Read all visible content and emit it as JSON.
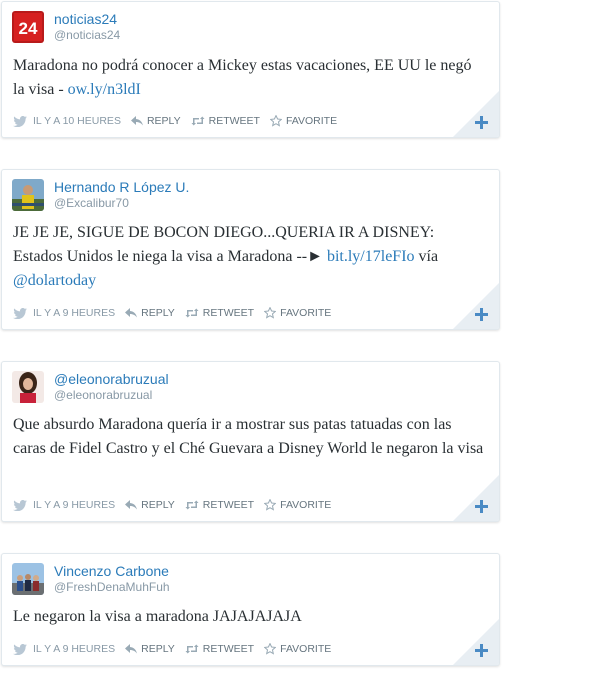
{
  "tweets": [
    {
      "display_name": "noticias24",
      "handle": "@noticias24",
      "text_parts": [
        "Maradona no podrá conocer a Mickey estas vacaciones, EE UU le negó la visa - ",
        "ow.ly/n3ldI"
      ],
      "time": "IL Y A 10 HEURES",
      "avatar_icon": "noticias24-logo-avatar"
    },
    {
      "display_name": "Hernando R López U.",
      "handle": "@Excalibur70",
      "text_parts": [
        "JE JE JE, SIGUE DE BOCON DIEGO...QUERIA IR A DISNEY: Estados Unidos le niega la visa a Maradona --► ",
        "bit.ly/17leFIo",
        " vía ",
        "@dolartoday"
      ],
      "time": "IL Y A 9 HEURES",
      "avatar_icon": "person-photo-avatar"
    },
    {
      "display_name": "@eleonorabruzual",
      "handle": "@eleonorabruzual",
      "text_parts": [
        "Que absurdo Maradona quería ir a mostrar sus patas tatuadas con las caras de Fidel Castro y el Ché Guevara a Disney World le negaron la visa"
      ],
      "time": "IL Y A 9 HEURES",
      "avatar_icon": "woman-photo-avatar"
    },
    {
      "display_name": "Vincenzo Carbone",
      "handle": "@FreshDenaMuhFuh",
      "text_parts": [
        "Le negaron la visa a maradona JAJAJAJAJA"
      ],
      "time": "IL Y A 9 HEURES",
      "avatar_icon": "group-photo-avatar"
    }
  ],
  "actions": {
    "reply": "REPLY",
    "retweet": "RETWEET",
    "favorite": "FAVORITE"
  },
  "colors": {
    "link": "#2b7bb9",
    "muted": "#8899a6",
    "text": "#292f33",
    "corner": "#e8eef3",
    "plus": "#4a8ac4"
  }
}
